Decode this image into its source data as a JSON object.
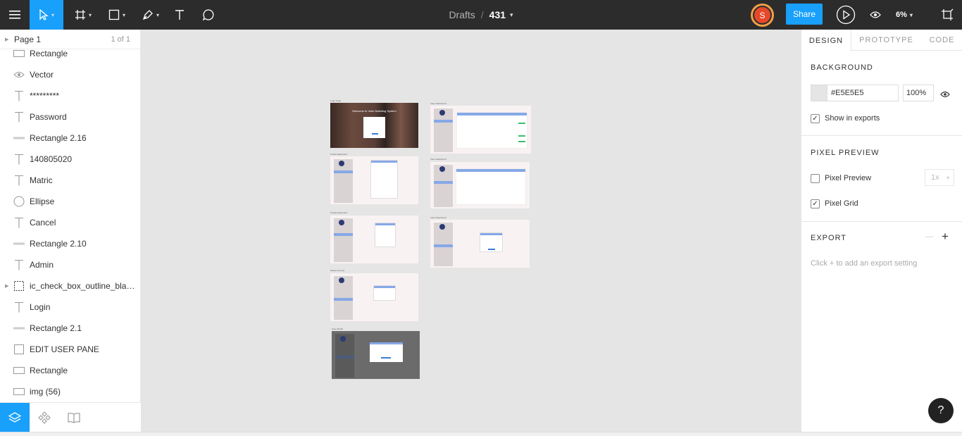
{
  "topbar": {
    "title_drafts": "Drafts",
    "title_sep": "/",
    "title_file": "431",
    "avatar_initial": "S",
    "share_label": "Share",
    "zoom_label": "6%"
  },
  "sidebar": {
    "page_name": "Page 1",
    "page_count": "1 of 1",
    "layers": [
      {
        "name": "Rectangle",
        "icon": "rectangle-icon"
      },
      {
        "name": "Vector",
        "icon": "eye-icon"
      },
      {
        "name": "*********",
        "icon": "text-icon"
      },
      {
        "name": "Password",
        "icon": "text-icon"
      },
      {
        "name": "Rectangle 2.16",
        "icon": "line-icon"
      },
      {
        "name": "140805020",
        "icon": "text-icon"
      },
      {
        "name": "Matric",
        "icon": "text-icon"
      },
      {
        "name": "Ellipse",
        "icon": "ellipse-icon"
      },
      {
        "name": "Cancel",
        "icon": "text-icon"
      },
      {
        "name": "Rectangle 2.10",
        "icon": "line-icon"
      },
      {
        "name": "Admin",
        "icon": "text-icon"
      },
      {
        "name": "ic_check_box_outline_blank_...",
        "icon": "frame-icon"
      },
      {
        "name": "Login",
        "icon": "text-icon"
      },
      {
        "name": "Rectangle 2.1",
        "icon": "line-icon"
      },
      {
        "name": "EDIT USER PANE",
        "icon": "square-icon"
      },
      {
        "name": "Rectangle",
        "icon": "rectangle-icon"
      },
      {
        "name": "img (56)",
        "icon": "rectangle-icon"
      }
    ]
  },
  "canvas": {
    "frame_title": "Welcome to Voter Balloting System"
  },
  "inspector": {
    "tabs": [
      "DESIGN",
      "PROTOTYPE",
      "CODE"
    ],
    "background_title": "BACKGROUND",
    "bg_hex": "#E5E5E5",
    "bg_opacity": "100%",
    "show_in_exports": "Show in exports",
    "pixel_preview_title": "PIXEL PREVIEW",
    "pixel_preview_label": "Pixel Preview",
    "pixel_preview_scale": "1x",
    "pixel_grid_label": "Pixel Grid",
    "export_title": "EXPORT",
    "export_hint": "Click + to add an export setting",
    "minus": "—",
    "plus": "+"
  },
  "help_label": "?",
  "colors": {
    "accent": "#18a0fb",
    "topbar": "#2c2c2c",
    "canvas": "#e5e5e5",
    "avatar": "#e5482a"
  }
}
